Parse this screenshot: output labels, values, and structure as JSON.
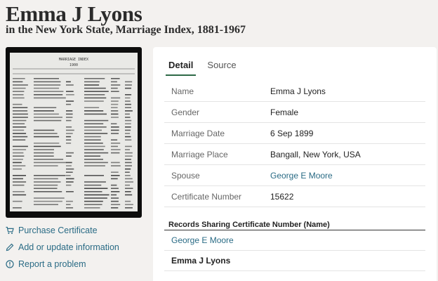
{
  "header": {
    "title": "Emma J Lyons",
    "subtitle": "in the New York State, Marriage Index, 1881-1967"
  },
  "image": {
    "heading": "MARRIAGE INDEX",
    "year": "1900"
  },
  "actions": [
    {
      "label": "Purchase Certificate",
      "icon": "cart-icon"
    },
    {
      "label": "Add or update information",
      "icon": "pencil-icon"
    },
    {
      "label": "Report a problem",
      "icon": "alert-circle-icon"
    }
  ],
  "tabs": [
    {
      "label": "Detail",
      "active": true
    },
    {
      "label": "Source",
      "active": false
    }
  ],
  "details": [
    {
      "label": "Name",
      "value": "Emma J Lyons"
    },
    {
      "label": "Gender",
      "value": "Female"
    },
    {
      "label": "Marriage Date",
      "value": "6 Sep 1899"
    },
    {
      "label": "Marriage Place",
      "value": "Bangall, New York, USA"
    },
    {
      "label": "Spouse",
      "value": "George E Moore"
    },
    {
      "label": "Certificate Number",
      "value": "15622"
    }
  ],
  "shared": {
    "title": "Records Sharing Certificate Number (Name)",
    "records": [
      "George E Moore",
      "Emma J Lyons"
    ]
  },
  "colors": {
    "link": "#2a6b85",
    "tab_underline": "#2e6a47",
    "background": "#f3f1ef"
  }
}
